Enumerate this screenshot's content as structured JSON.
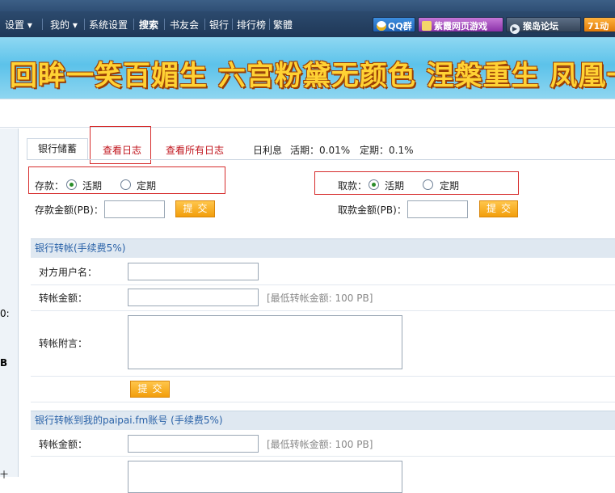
{
  "nav": {
    "items": [
      "设置 ▾",
      "我的 ▾",
      "系统设置",
      "搜索",
      "书友会",
      "银行",
      "排行榜",
      "繁體"
    ],
    "qq_button": "QQ群",
    "game_button": "紫霞网页游戏",
    "forum_button": "猴岛论坛",
    "anime_button": "71动"
  },
  "banner": {
    "text": "回眸一笑百媚生  六宫粉黛无颜色  涅槃重生  凤凰一诀"
  },
  "left_pane": {
    "fragment_1": "0:",
    "fragment_2": "B",
    "fragment_3": "十"
  },
  "tabs": {
    "savings": "银行储蓄",
    "view_log": "查看日志",
    "view_all_logs": "查看所有日志"
  },
  "interest": {
    "label": "日利息",
    "current": "活期：0.01%",
    "fixed": "定期：0.1%"
  },
  "deposit": {
    "label": "存款：",
    "option_current": "活期",
    "option_fixed": "定期",
    "selected": "活期",
    "amount_label": "存款金额(PB)：",
    "amount_value": "",
    "submit": "提交"
  },
  "withdraw": {
    "label": "取款：",
    "option_current": "活期",
    "option_fixed": "定期",
    "selected": "活期",
    "amount_label": "取款金额(PB)：",
    "amount_value": "",
    "submit": "提交"
  },
  "transfer": {
    "heading": "银行转帐(手续费5%)",
    "recipient_label": "对方用户名：",
    "recipient_value": "",
    "amount_label": "转帐金额：",
    "amount_value": "",
    "amount_hint": "[最低转帐金额: 100 PB]",
    "note_label": "转帐附言：",
    "note_value": "",
    "submit": "提交"
  },
  "paipai_transfer": {
    "heading": "银行转帐到我的paipai.fm账号 (手续费5%)",
    "amount_label": "转帐金额：",
    "amount_value": "",
    "amount_hint": "[最低转帐金额: 100 PB]"
  },
  "colors": {
    "nav_bg": "#1f3857",
    "banner_text": "#ffd234",
    "tab_red": "#c0141c",
    "section_bg": "#dfe8f1",
    "section_text": "#2a62a8",
    "button": "#f29e0c",
    "highlight_box": "#d62c2c"
  }
}
